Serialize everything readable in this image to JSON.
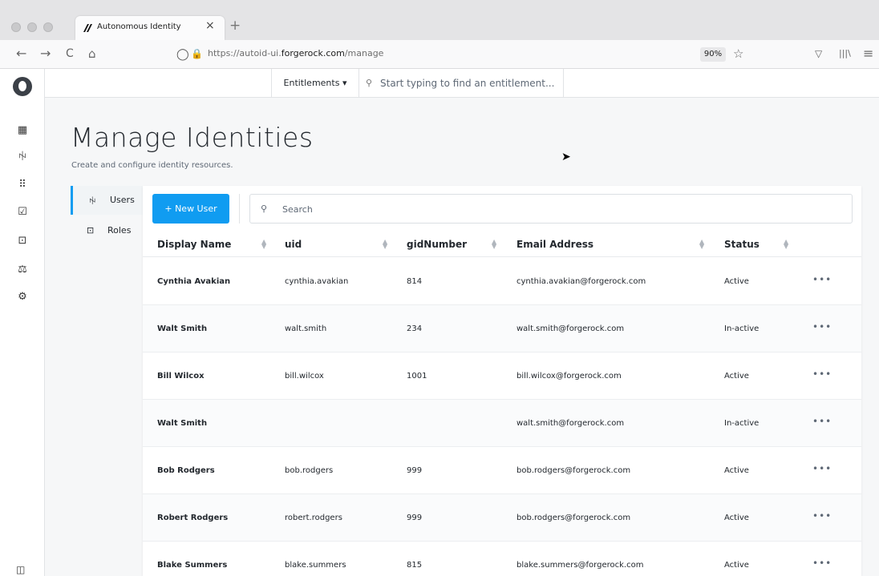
{
  "browser": {
    "tab_title": "Autonomous Identity",
    "tab_close": "×",
    "new_tab": "+",
    "url_prefix": "https://autoid-ui.",
    "url_domain": "forgerock.com",
    "url_path": "/manage",
    "zoom": "90%",
    "nav": {
      "back": "←",
      "forward": "→",
      "reload": "C",
      "home": "⌂",
      "shield": "◯",
      "lock": "🔒",
      "star": "☆",
      "pocket": "▽",
      "library": "|||\\",
      "menu": "≡"
    }
  },
  "appbar": {
    "entitlements_dropdown": "Entitlements ▾",
    "search_placeholder": "Start typing to find an entitlement..."
  },
  "page": {
    "title": "Manage Identities",
    "subtitle": "Create and configure identity resources."
  },
  "sidenav": {
    "items": [
      {
        "label": "Users",
        "icon": "users-icon",
        "active": true
      },
      {
        "label": "Roles",
        "icon": "roles-icon",
        "active": false
      }
    ]
  },
  "toolbar": {
    "new_user_label": "+ New User",
    "search_placeholder": "Search"
  },
  "table": {
    "columns": [
      "Display Name",
      "uid",
      "gidNumber",
      "Email Address",
      "Status"
    ],
    "rows": [
      {
        "display_name": "Cynthia Avakian",
        "uid": "cynthia.avakian",
        "gid": "814",
        "email": "cynthia.avakian@forgerock.com",
        "status": "Active"
      },
      {
        "display_name": "Walt Smith",
        "uid": "walt.smith",
        "gid": "234",
        "email": "walt.smith@forgerock.com",
        "status": "In-active"
      },
      {
        "display_name": "Bill Wilcox",
        "uid": "bill.wilcox",
        "gid": "1001",
        "email": "bill.wilcox@forgerock.com",
        "status": "Active"
      },
      {
        "display_name": "Walt Smith",
        "uid": "",
        "gid": "",
        "email": "walt.smith@forgerock.com",
        "status": "In-active"
      },
      {
        "display_name": "Bob Rodgers",
        "uid": "bob.rodgers",
        "gid": "999",
        "email": "bob.rodgers@forgerock.com",
        "status": "Active"
      },
      {
        "display_name": "Robert Rodgers",
        "uid": "robert.rodgers",
        "gid": "999",
        "email": "bob.rodgers@forgerock.com",
        "status": "Active"
      },
      {
        "display_name": "Blake Summers",
        "uid": "blake.summers",
        "gid": "815",
        "email": "blake.summers@forgerock.com",
        "status": "Active"
      }
    ],
    "row_actions": "•••"
  },
  "colors": {
    "accent": "#109cf1",
    "text": "#23282e",
    "muted": "#5e6875",
    "background": "#f6f7f8"
  }
}
